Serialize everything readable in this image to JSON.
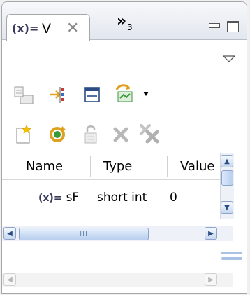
{
  "tabs": {
    "active": {
      "icon": "variables-icon",
      "icon_text": "(x)=",
      "label": "V"
    },
    "overflow_count": "3"
  },
  "table": {
    "columns": [
      "Name",
      "Type",
      "Value"
    ],
    "rows": [
      {
        "icon_text": "(x)=",
        "name": "sF",
        "type": "short int",
        "value": "0"
      }
    ]
  },
  "scrollbar": {
    "grip": "III"
  },
  "toolbar1": {
    "icons": [
      "collapse-all-icon",
      "show-type-names-icon",
      "layout-toggle-icon",
      "select-columns-icon"
    ]
  },
  "toolbar2": {
    "icons": [
      "new-variable-icon",
      "refresh-icon",
      "lock-icon",
      "remove-icon",
      "remove-all-icon"
    ]
  },
  "colors": {
    "accent": "#2a4d84",
    "scroll_thumb": "#b8cfee",
    "icon_gold": "#e0a020",
    "icon_green": "#3a9a3a",
    "icon_red": "#c23a3a"
  }
}
